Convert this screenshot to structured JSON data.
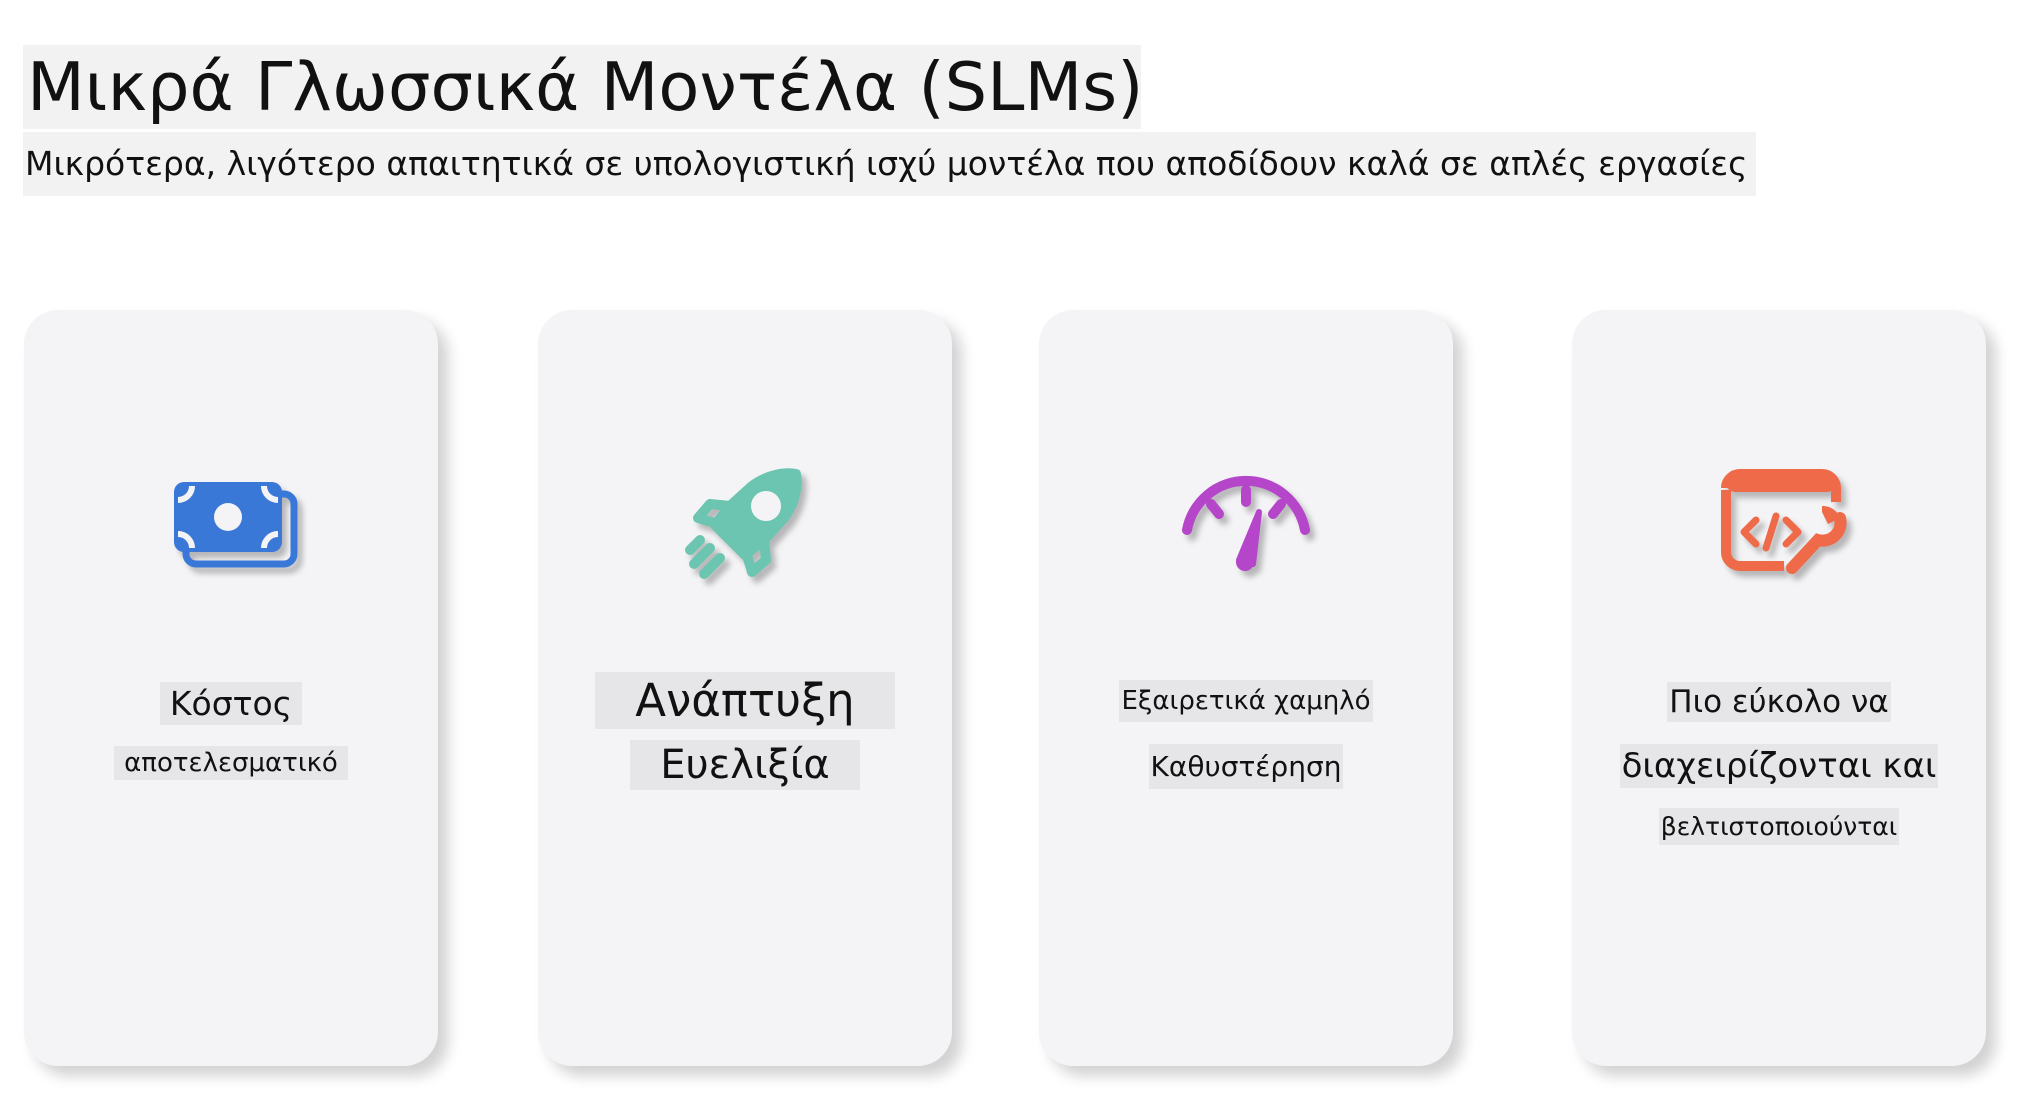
{
  "header": {
    "title": "Μικρά Γλωσσικά Μοντέλα (SLMs)",
    "subtitle": "Μικρότερα, λιγότερο απαιτητικά σε υπολογιστική ισχύ μοντέλα που αποδίδουν καλά σε απλές εργασίες"
  },
  "cards": [
    {
      "icon": "money-icon",
      "color": "#3a78d8",
      "line1": "Κόστος",
      "line2": "αποτελεσματικό"
    },
    {
      "icon": "rocket-icon",
      "color": "#6cc5b0",
      "line1": "Ανάπτυξη",
      "line2": "Ευελιξία"
    },
    {
      "icon": "speedometer-icon",
      "color": "#b545c9",
      "line1": "Εξαιρετικά χαμηλό",
      "line2": "Καθυστέρηση"
    },
    {
      "icon": "code-wrench-icon",
      "color": "#ee6a48",
      "line1": "Πιο εύκολο να",
      "line2": "διαχειρίζονται και",
      "line3": "βελτιστοποιούνται"
    }
  ]
}
